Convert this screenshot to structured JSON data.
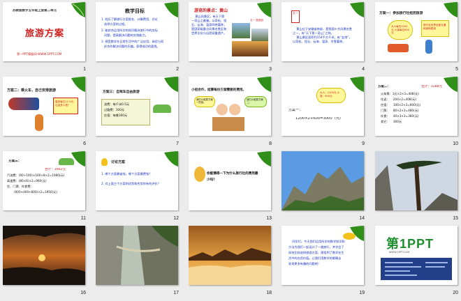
{
  "slides": [
    {
      "n": "1",
      "header": "苏教版数学五年级上册第二单元",
      "title": "旅游方案",
      "footer": "第一PPT模板网-WWW.1PPT.COM"
    },
    {
      "n": "2",
      "title": "教学目标",
      "lines": [
        "1. 经历了解旅行方案报名、计算费用、讨论",
        "   选择方案的过程。",
        "2. 能综合运用所学的知识解决旅行中的实际",
        "   问题，提高解决问题的实践能力。",
        "3. 感受数学在日常生活中的广泛应用，体验与同",
        "   伴合作解决问题的乐趣。获得成功的喜悦。"
      ]
    },
    {
      "n": "3",
      "title": "游览的景点：黄山",
      "lines": [
        "    黄山风景区，有天下第",
        "一奇山之美誉。以奇松、怪",
        "石、云海、温泉四绝著称，",
        "是国家级重点风景名胜区和",
        "世界文化与自然双重遗产。"
      ],
      "badge": "五一 旅游团"
    },
    {
      "n": "4",
      "tag": "五一",
      "lines": [
        "    黄山位于安徽省南部，是我国十大风景名胜",
        "之一，有“天下第一奇山”之称。",
        "    黄山景区面积约154平方千米，有“五绝”，",
        "以奇松、怪石、云海、温泉、冬雪著称。"
      ]
    },
    {
      "n": "5",
      "title": "方案一：参加旅行社组团旅游",
      "bubble_left": "大人每位1200元 小孩每位600元",
      "bubble_right": "旅行社负责全部交通和食宿费用"
    },
    {
      "n": "6",
      "title": "方案二：乘火车，自己安排旅游",
      "bubble": "高铁每位12.5元，往返多少钱？"
    },
    {
      "n": "7",
      "title": "方案三：自驾车自由旅游",
      "lines": [
        "油费：每千米0.5元",
        "过路费：100元",
        "住宿：每晚300元"
      ]
    },
    {
      "n": "8",
      "title": "小组合作，结算每份方案需要的费用。",
      "bubble1": "我们小组算方案一的钱。",
      "bubble2": "我们小组算方案二。"
    },
    {
      "n": "9",
      "label": "方案一：",
      "formula": "1200×2+600=3000（元）",
      "box": "大人：1200元 小孩：600元"
    },
    {
      "n": "10",
      "label": "方案二：",
      "lines": [
        "火车票：1元×2×3=408(元)",
        "往返：    204×2=408(元)",
        "住宿：    100×2×3=600(元)",
        "门票：    80×2×3=480(元)",
        "伙食：    40×3×3=360(元)",
        "其它：    300元"
      ],
      "total": "合计：3288元"
    },
    {
      "n": "11",
      "label": "方案三：",
      "lines": [
        "合计：3992元",
        "汽油费：(60÷100)×100×8×2=1080(元)",
        "高速费：(80×6)×2=960(元)",
        "住、门票、伙食费：",
        "(600+400+600)×2=1950(元)"
      ]
    },
    {
      "n": "12",
      "title": "讨论方案",
      "lines": [
        "1. 哪个方案最省钱，哪个方案最费钱？",
        "2. 对上面三个方案的优势和劣势你有何评价？"
      ]
    },
    {
      "n": "13",
      "question": "你能猜得一下为什么旅行社的费用最少吗？"
    },
    {
      "n": "14"
    },
    {
      "n": "15"
    },
    {
      "n": "16"
    },
    {
      "n": "17"
    },
    {
      "n": "18"
    },
    {
      "n": "19",
      "lines": [
        "    同学们，今天我们运用所学的数学知识和",
        "方法为我们一起设计了一趟旅行，并学会了",
        "如何比较选择旅游方案，感悟到了数学在生",
        "活中的应用价值。让我们用数学的眼睛去",
        "发现更多有趣的问题吧！"
      ]
    },
    {
      "n": "20",
      "logo": "第1PPT",
      "subtitle": "WWW.1PPT.COM"
    }
  ],
  "colors": {
    "bg": "#ececec",
    "blue": "#1230c0",
    "red": "#d21c1c",
    "leaf": "#2f8f18"
  }
}
